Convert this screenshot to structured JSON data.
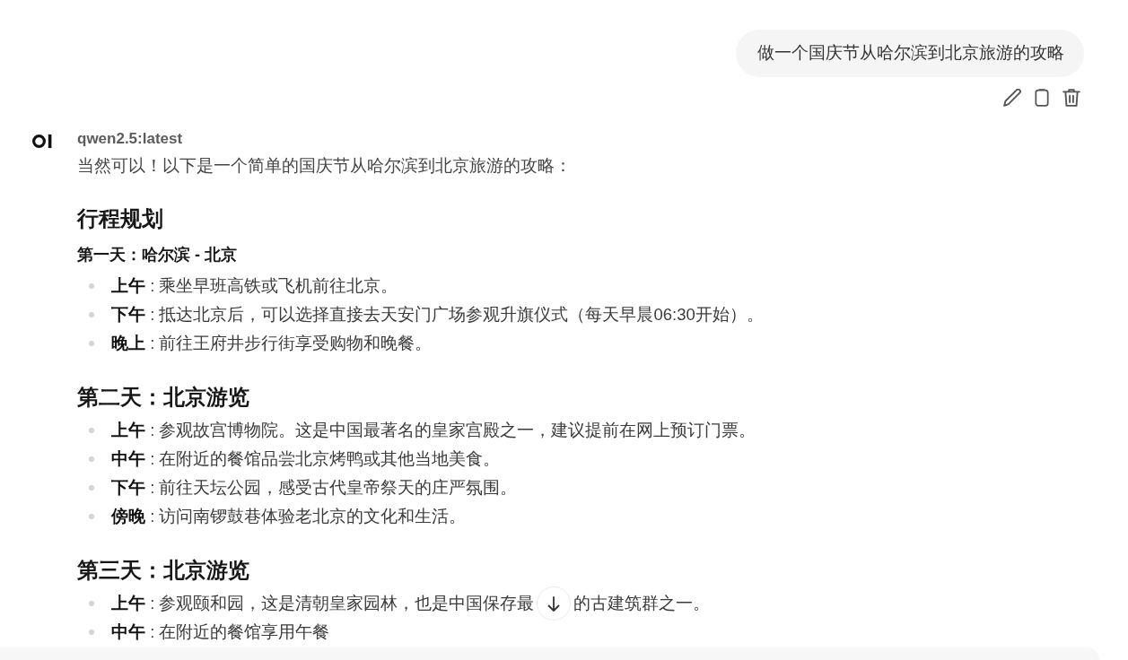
{
  "user_message": {
    "text": "做一个国庆节从哈尔滨到北京旅游的攻略"
  },
  "assistant_message": {
    "model": "qwen2.5:latest",
    "intro": "当然可以！以下是一个简单的国庆节从哈尔滨到北京旅游的攻略：",
    "blocks": [
      {
        "kind": "heading",
        "text": "行程规划"
      },
      {
        "kind": "subheading",
        "text": "第一天：哈尔滨 - 北京"
      },
      {
        "kind": "list",
        "items": [
          {
            "text": "**上午** : 乘坐早班高铁或飞机前往北京。"
          },
          {
            "text": "**下午** : 抵达北京后，可以选择直接去天安门广场参观升旗仪式（每天早晨06:30开始）。"
          },
          {
            "text": "**晚上** : 前往王府井步行街享受购物和晚餐。"
          }
        ]
      },
      {
        "kind": "heading",
        "text": "第二天：北京游览"
      },
      {
        "kind": "list",
        "items": [
          {
            "text": "**上午** : 参观故宫博物院。这是中国最著名的皇家宫殿之一，建议提前在网上预订门票。"
          },
          {
            "text": "**中午** : 在附近的餐馆品尝北京烤鸭或其他当地美食。"
          },
          {
            "text": "**下午** : 前往天坛公园，感受古代皇帝祭天的庄严氛围。"
          },
          {
            "text": "**傍晚** : 访问南锣鼓巷体验老北京的文化和生活。"
          }
        ]
      },
      {
        "kind": "heading",
        "text": "第三天：北京游览"
      },
      {
        "kind": "list",
        "items": [
          {
            "text": "**上午** : 参观颐和园，这是清朝皇家园林，也是中国保存最",
            "text_after_cover": "的古建筑群之一。"
          },
          {
            "text": "**中午** : 在附近的餐馆享用午餐"
          }
        ]
      }
    ]
  }
}
